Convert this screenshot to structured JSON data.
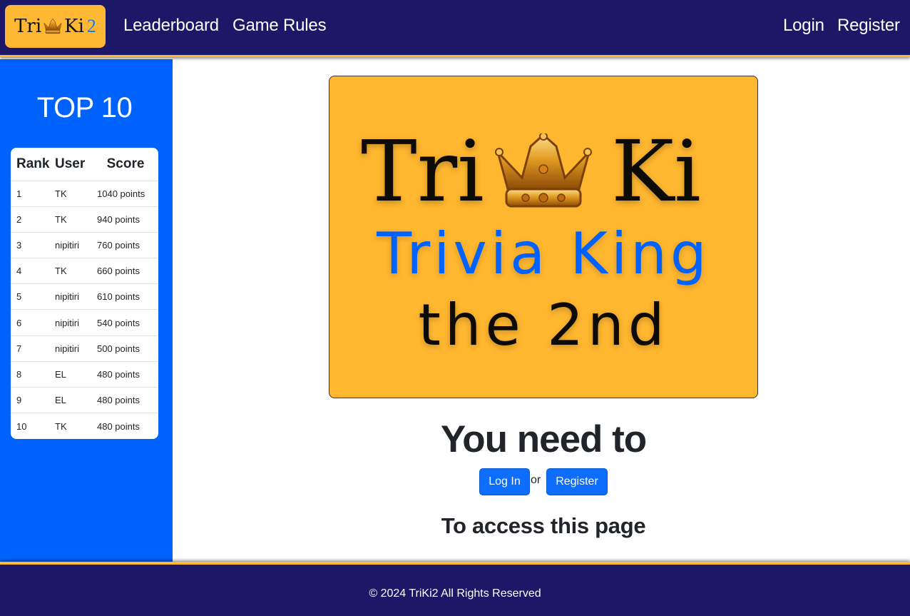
{
  "navbar": {
    "brand": {
      "part1": "Tri",
      "part2": "Ki",
      "part3": "2"
    },
    "links": {
      "leaderboard": "Leaderboard",
      "game_rules": "Game Rules",
      "login": "Login",
      "register": "Register"
    }
  },
  "sidebar": {
    "title": "TOP 10",
    "columns": {
      "rank": "Rank",
      "user": "User",
      "score": "Score"
    },
    "rows": [
      {
        "rank": "1",
        "user": "TK",
        "score": "1040 points"
      },
      {
        "rank": "2",
        "user": "TK",
        "score": "940 points"
      },
      {
        "rank": "3",
        "user": "nipitiri",
        "score": "760 points"
      },
      {
        "rank": "4",
        "user": "TK",
        "score": "660 points"
      },
      {
        "rank": "5",
        "user": "nipitiri",
        "score": "610 points"
      },
      {
        "rank": "6",
        "user": "nipitiri",
        "score": "540 points"
      },
      {
        "rank": "7",
        "user": "nipitiri",
        "score": "500 points"
      },
      {
        "rank": "8",
        "user": "EL",
        "score": "480 points"
      },
      {
        "rank": "9",
        "user": "EL",
        "score": "480 points"
      },
      {
        "rank": "10",
        "user": "TK",
        "score": "480 points"
      }
    ]
  },
  "main": {
    "logo": {
      "word1": "Tri",
      "word2": "Ki",
      "subtitle": "Trivia King",
      "tagline": "the 2nd"
    },
    "heading": "You need to",
    "login_button": "Log In",
    "or_text": "or",
    "register_button": "Register",
    "subheading": "To access this page"
  },
  "footer": {
    "text": "© 2024 TriKi2 All Rights Reserved"
  },
  "colors": {
    "navbar_bg": "#1c1766",
    "accent_gold": "#ffb833",
    "sidebar_blue": "#0062fc",
    "button_blue": "#0d6efd"
  },
  "icons": {
    "brand_crown": "crown-icon",
    "logo_crown": "crown-icon"
  }
}
